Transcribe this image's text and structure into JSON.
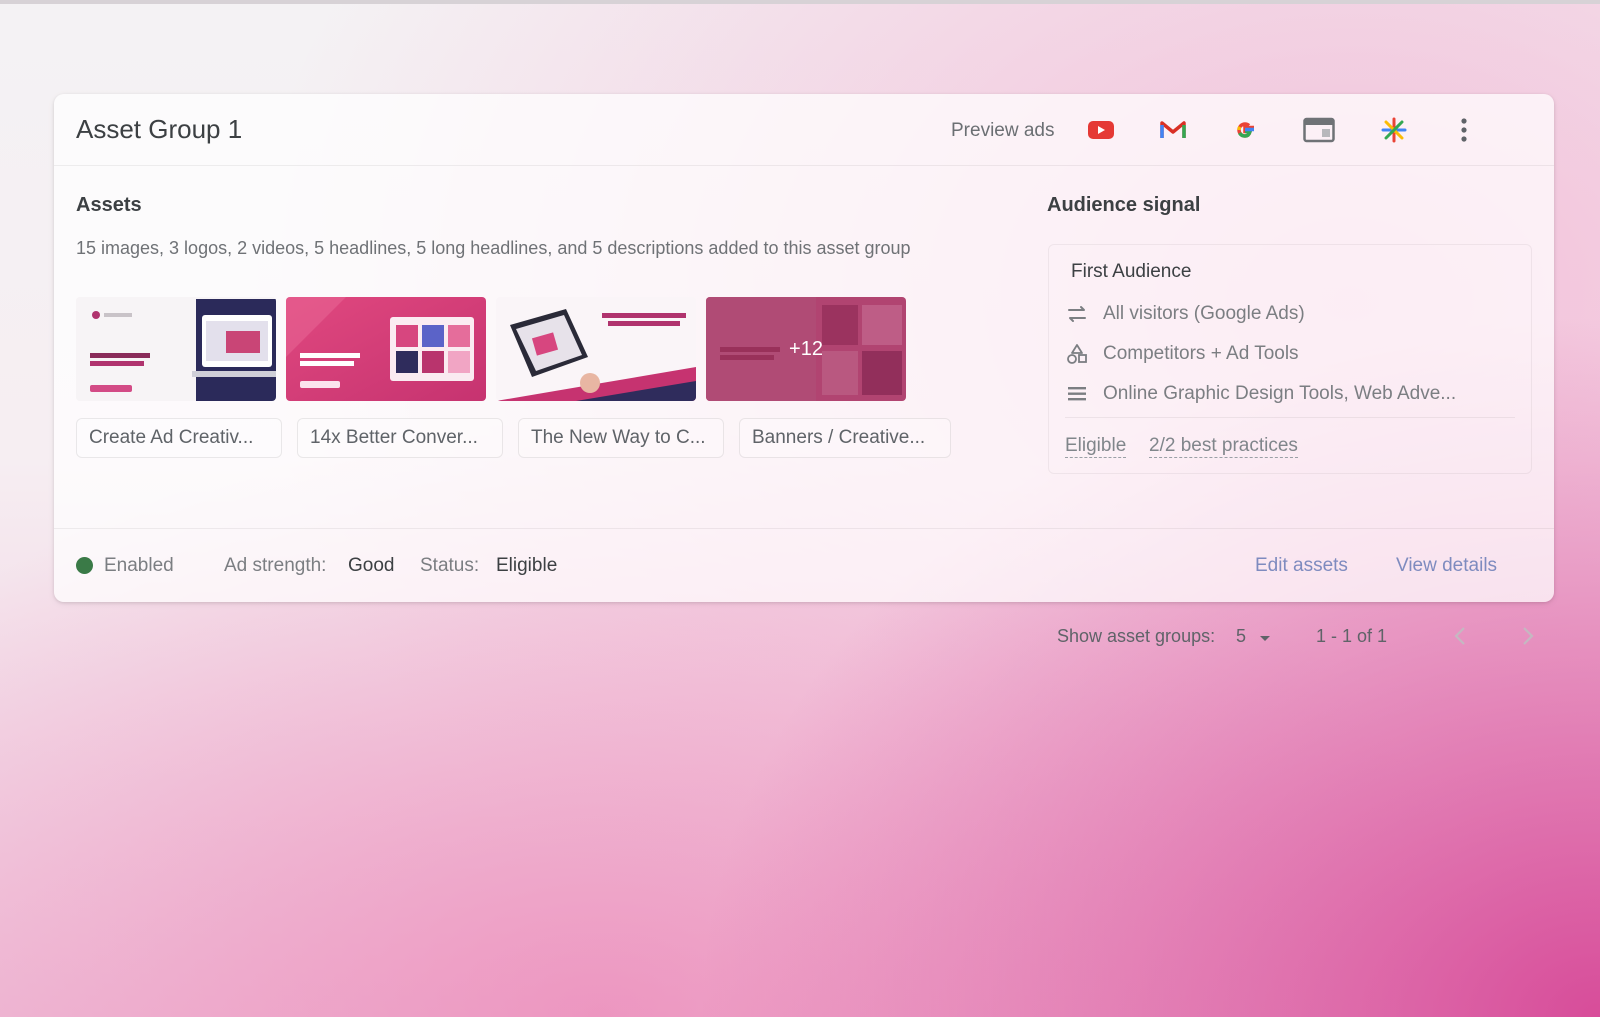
{
  "asset_group": {
    "title": "Asset Group 1",
    "preview_label": "Preview ads",
    "preview_icons": [
      "youtube-icon",
      "gmail-icon",
      "google-icon",
      "display-icon",
      "discover-icon"
    ],
    "more_icon": "more-vert-icon"
  },
  "assets": {
    "title": "Assets",
    "description": "15 images, 3 logos, 2 videos, 5 headlines, 5 long headlines, and 5 descriptions added to this asset group",
    "more_count": "+12",
    "chips": [
      "Create Ad Creativ...",
      "14x Better Conver...",
      "The New Way to C...",
      "Banners / Creative..."
    ]
  },
  "audience": {
    "title": "Audience signal",
    "name": "First Audience",
    "items": [
      "All visitors (Google Ads)",
      "Competitors + Ad Tools",
      "Online Graphic Design Tools, Web Adve..."
    ],
    "status": "Eligible",
    "best_practices": "2/2 best practices"
  },
  "footer": {
    "status_label": "Enabled",
    "status_color": "#3a7a47",
    "ad_strength_label": "Ad strength:",
    "ad_strength_value": "Good",
    "status_field_label": "Status:",
    "status_value": "Eligible",
    "edit_assets": "Edit assets",
    "view_details": "View details"
  },
  "pagination": {
    "show_label": "Show asset groups:",
    "show_value": "5",
    "range": "1 - 1 of 1"
  },
  "colors": {
    "accent_link": "#7e8bbf",
    "youtube_red": "#e53935",
    "gradient_pink": "#d6469a"
  }
}
